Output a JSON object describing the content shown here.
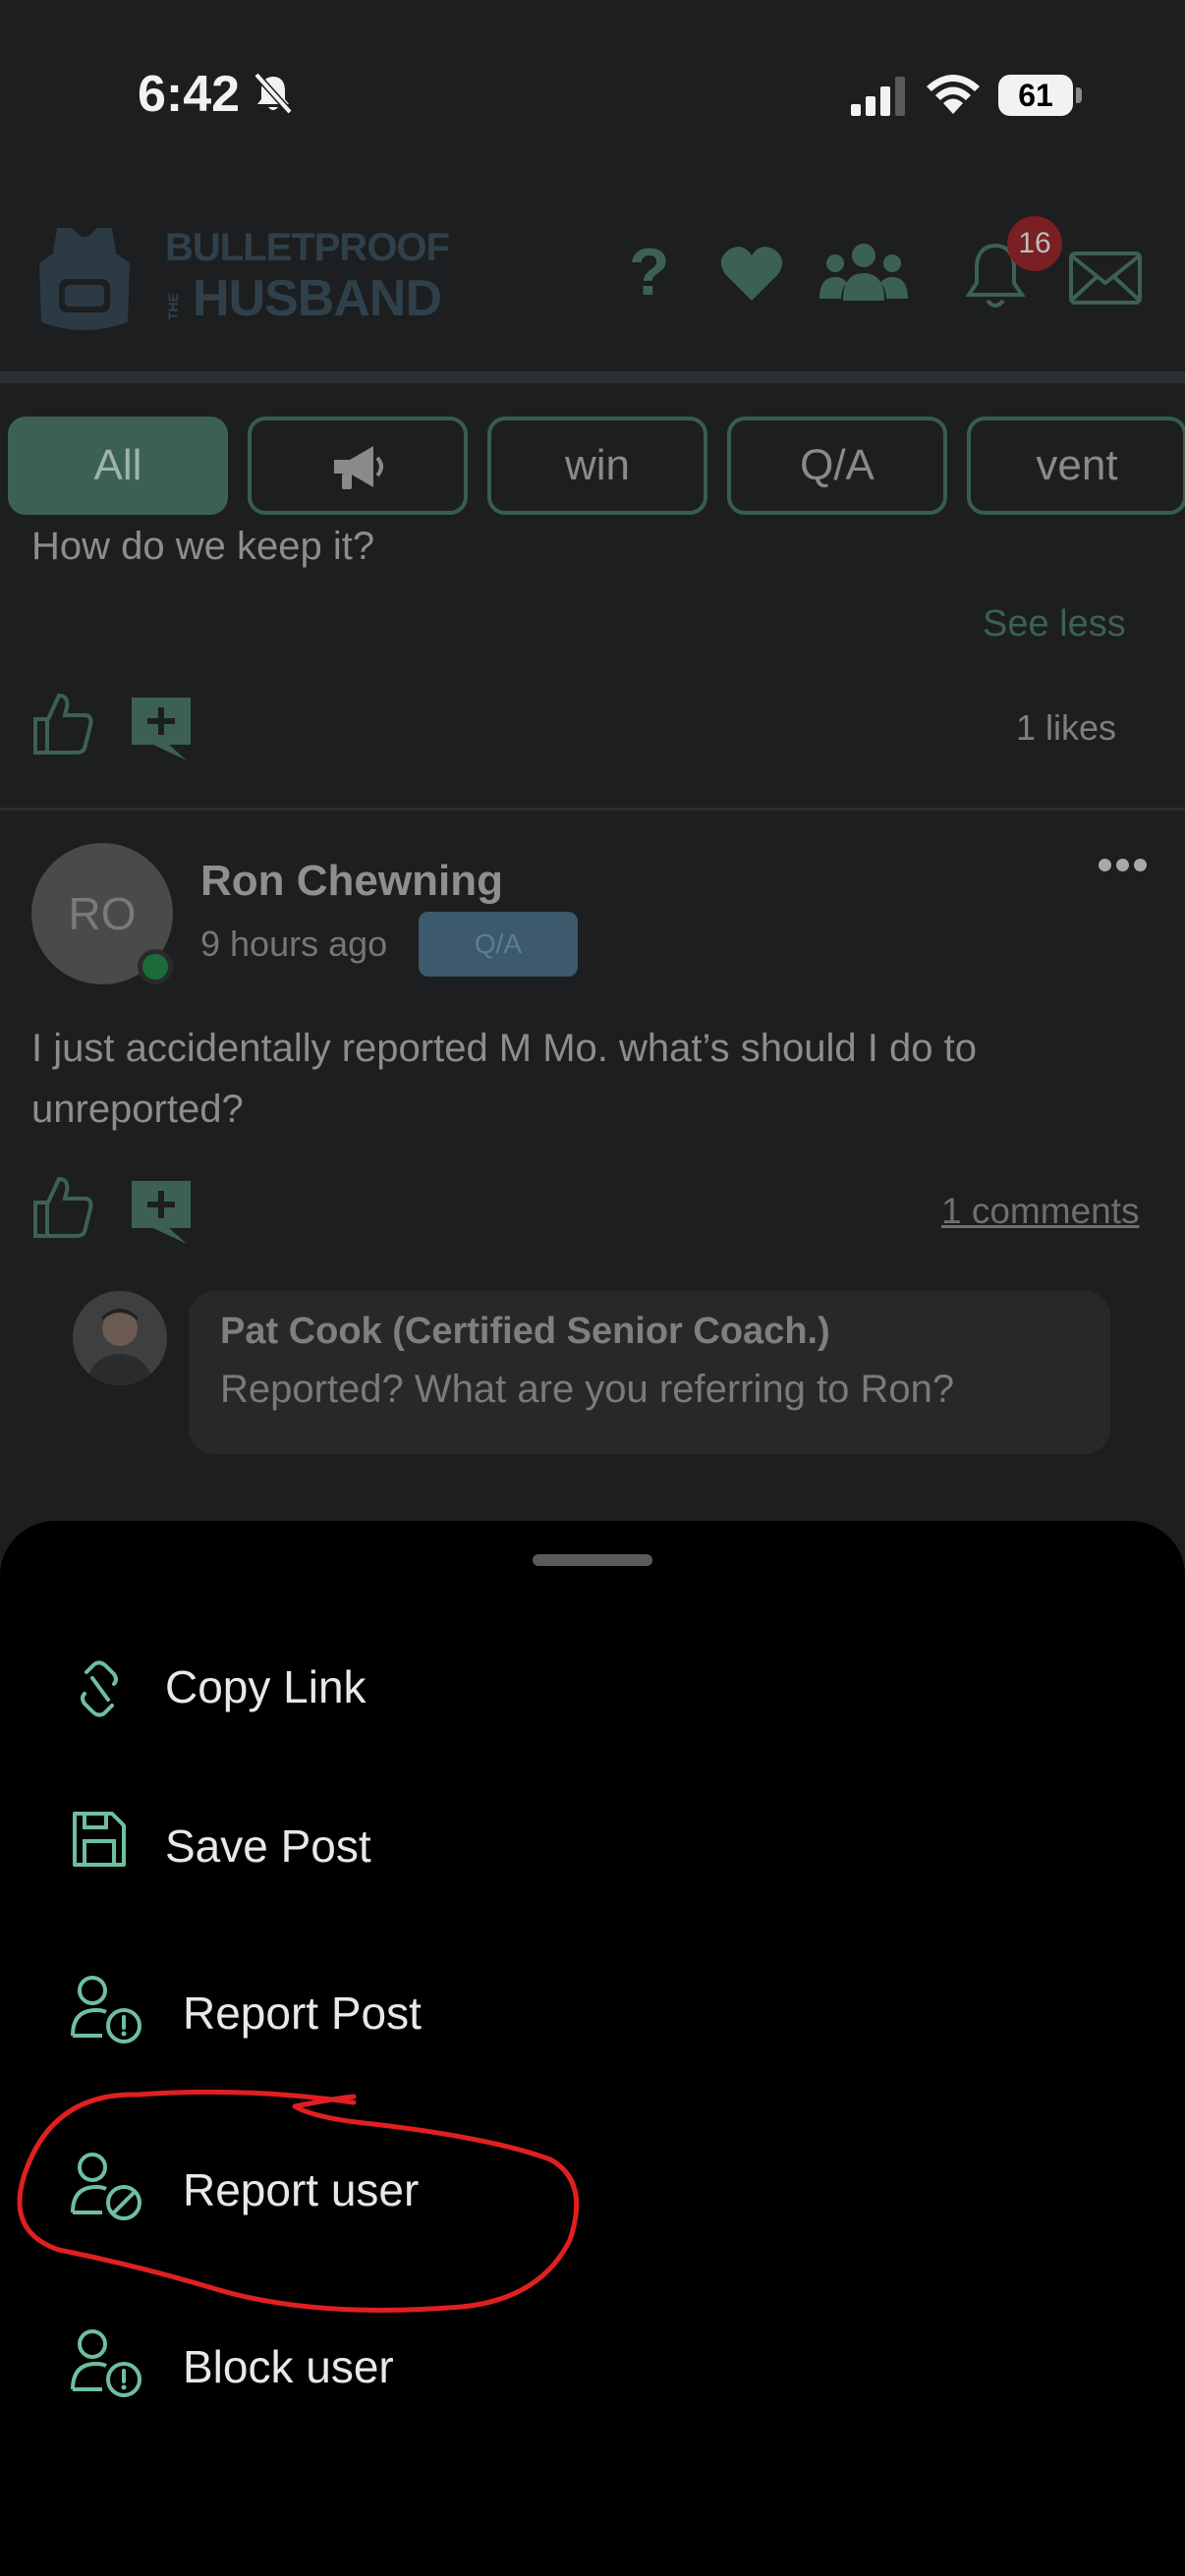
{
  "status_bar": {
    "time": "6:42",
    "battery": "61"
  },
  "header": {
    "logo_line1": "BULLETPROOF",
    "logo_the": "THE",
    "logo_line2": "HUSBAND",
    "help_glyph": "?",
    "notification_count": "16"
  },
  "filters": [
    {
      "label": "All",
      "active": true
    },
    {
      "label": "",
      "icon": "megaphone-icon"
    },
    {
      "label": "win"
    },
    {
      "label": "Q/A"
    },
    {
      "label": "vent"
    }
  ],
  "previous_post": {
    "partial_text": "How do we keep it?",
    "see_less": "See less",
    "likes": "1 likes"
  },
  "post": {
    "avatar_initials": "RO",
    "author": "Ron Chewning",
    "time_ago": "9 hours ago",
    "tag": "Q/A",
    "text": "I just accidentally reported M Mo.  what’s should I do to unreported?",
    "comments_link": "1 comments",
    "comment": {
      "author": "Pat Cook (Certified Senior Coach.)",
      "text": "Reported? What are you referring to Ron?"
    }
  },
  "sheet": {
    "items": [
      {
        "label": "Copy Link",
        "icon": "link-icon"
      },
      {
        "label": "Save Post",
        "icon": "save-icon"
      },
      {
        "label": "Report Post",
        "icon": "user-alert-icon"
      },
      {
        "label": "Report user",
        "icon": "user-block-icon"
      },
      {
        "label": "Block user",
        "icon": "user-alert-icon"
      }
    ]
  },
  "colors": {
    "accent": "#6fbf9f",
    "dim_accent": "#3c6153",
    "annotation": "#e02020",
    "badge": "#7a1f22"
  }
}
